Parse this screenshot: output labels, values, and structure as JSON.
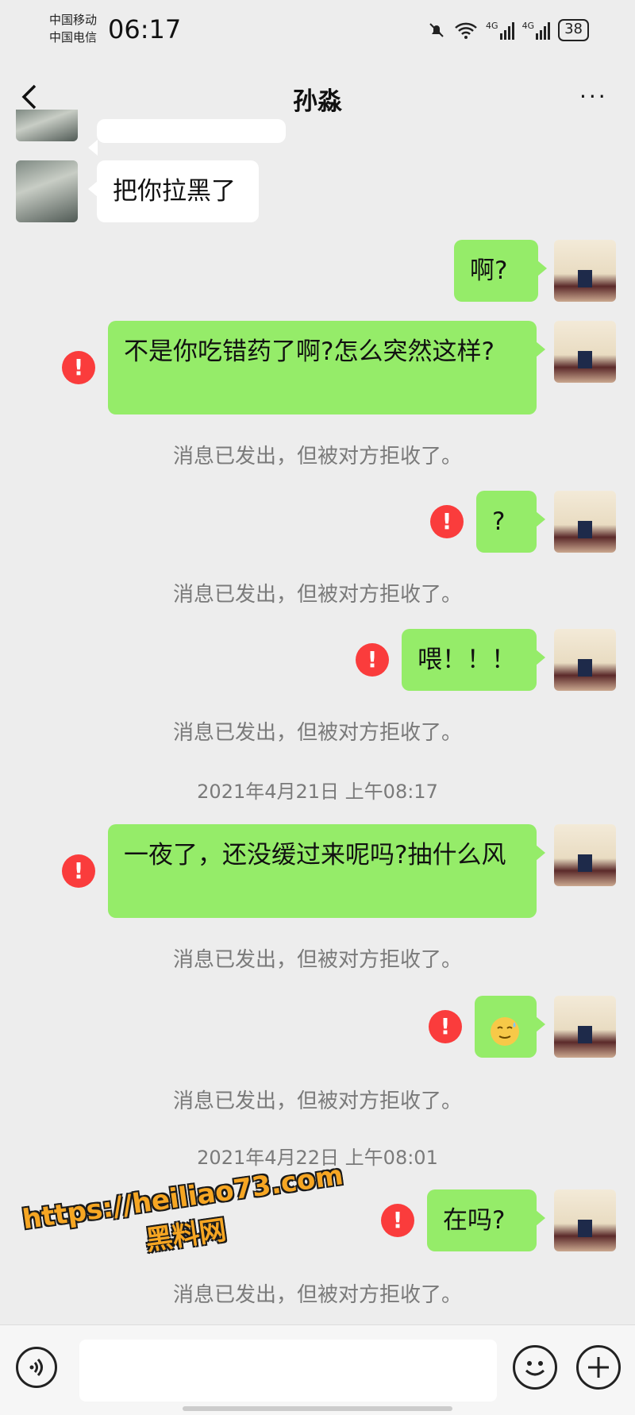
{
  "status_bar": {
    "carrier_1": "中国移动",
    "carrier_2": "中国电信",
    "time": "06:17",
    "net_1": "4G",
    "net_2": "4G",
    "battery": "38",
    "icons": [
      "mute-bell-icon",
      "wifi-icon",
      "signal-icon",
      "signal-icon",
      "battery-icon"
    ]
  },
  "header": {
    "title": "孙淼",
    "more": "···"
  },
  "messages": [
    {
      "side": "in",
      "text": "把你拉黑了"
    },
    {
      "side": "out",
      "text": "啊?"
    },
    {
      "side": "out",
      "text": "不是你吃错药了啊?怎么突然这样?",
      "failed": true,
      "notice": "消息已发出，但被对方拒收了。"
    },
    {
      "side": "out",
      "text": "?",
      "failed": true,
      "notice": "消息已发出，但被对方拒收了。"
    },
    {
      "side": "out",
      "text": "喂！！！",
      "failed": true,
      "notice": "消息已发出，但被对方拒收了。"
    },
    {
      "timestamp": "2021年4月21日 上午08:17"
    },
    {
      "side": "out",
      "text": "一夜了，还没缓过来呢吗?抽什么风",
      "failed": true,
      "notice": "消息已发出，但被对方拒收了。"
    },
    {
      "side": "out",
      "emoji": "sweat-smile-emoji",
      "failed": true,
      "notice": "消息已发出，但被对方拒收了。"
    },
    {
      "timestamp": "2021年4月22日 上午08:01"
    },
    {
      "side": "out",
      "text": "在吗?",
      "failed": true,
      "notice": "消息已发出，但被对方拒收了。"
    }
  ],
  "error_mark": "!",
  "watermark": {
    "line1": "https://heiliao73.com",
    "line2": "黑料网"
  },
  "input": {
    "placeholder": ""
  },
  "colors": {
    "outgoing": "#95ec69",
    "incoming": "#ffffff",
    "error": "#fa3c3c",
    "background": "#ededed"
  }
}
